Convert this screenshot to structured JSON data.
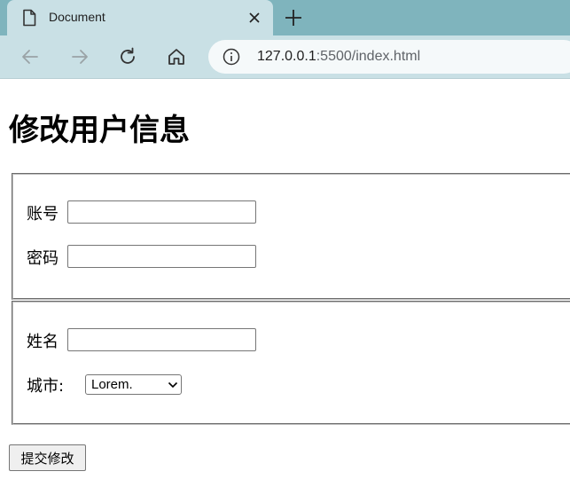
{
  "browser": {
    "tab_title": "Document",
    "url_host": "127.0.0.1",
    "url_rest": ":5500/index.html"
  },
  "page": {
    "title": "修改用户信息",
    "account_label": "账号",
    "password_label": "密码",
    "name_label": "姓名",
    "city_label": "城市:",
    "city_selected": "Lorem.",
    "submit_label": "提交修改"
  }
}
